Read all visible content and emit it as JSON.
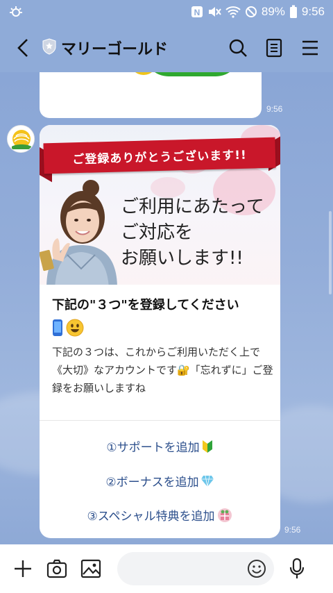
{
  "status_bar": {
    "battery": "89%",
    "time": "9:56"
  },
  "header": {
    "title": "マリーゴールド"
  },
  "messages": {
    "prev_time": "9:56",
    "card_time": "9:56"
  },
  "card": {
    "banner_ribbon": "ご登録ありがとうございます!!",
    "banner_lines": [
      "ご利用にあたって",
      "ご対応を",
      "お願いします!!"
    ],
    "title": "下記の\"３つ\"を登録してください",
    "description": "下記の３つは、これからご利用いただく上で《大切》なアカウントです🔐「忘れずに」ご登録をお願いしますね",
    "actions": [
      {
        "label": "①サポートを追加"
      },
      {
        "label": "②ボーナスを追加"
      },
      {
        "label": "③スペシャル特典を追加"
      }
    ]
  },
  "colors": {
    "chat_bg": "#8aa6d4",
    "ribbon": "#c9172a",
    "action_text": "#2c4f8c"
  },
  "icons": [
    "wifi-icon",
    "mute-icon",
    "nfc-icon",
    "battery-icon",
    "back-icon",
    "shield-icon",
    "search-icon",
    "notes-icon",
    "menu-icon",
    "plus-icon",
    "camera-icon",
    "image-icon",
    "emoji-icon",
    "mic-icon"
  ]
}
